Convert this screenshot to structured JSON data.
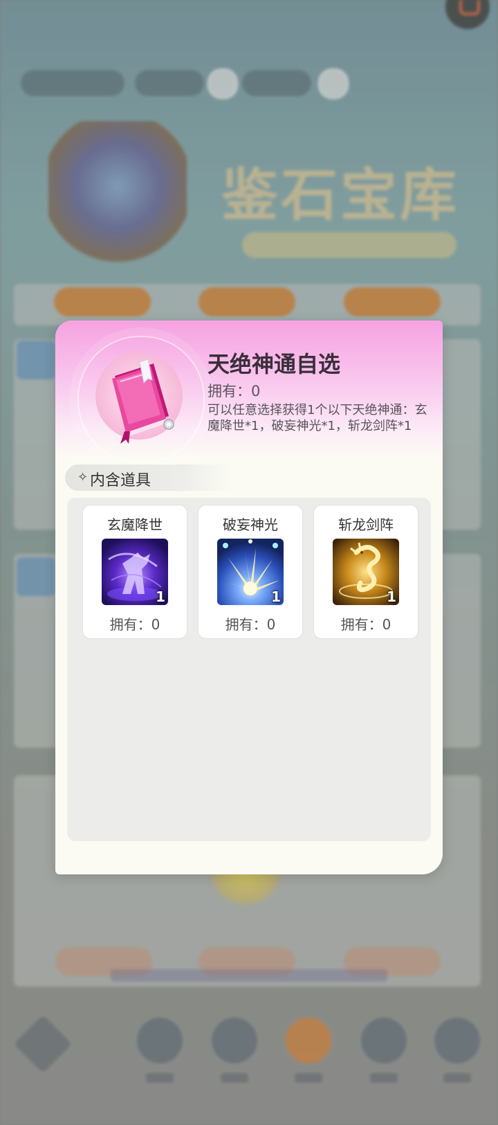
{
  "popup": {
    "title": "天绝神通自选",
    "owned": "拥有：0",
    "description": "可以任意选择获得1个以下天绝神通：玄魔降世*1，破妄神光*1，斩龙剑阵*1"
  },
  "contents": {
    "header": "内含道具",
    "header_icon": "✧",
    "items": [
      {
        "name": "玄魔降世",
        "quantity": "1",
        "owned": "拥有：0",
        "icon": "dark-demon-skill-icon"
      },
      {
        "name": "破妄神光",
        "quantity": "1",
        "owned": "拥有：0",
        "icon": "divine-light-burst-icon"
      },
      {
        "name": "斩龙剑阵",
        "quantity": "1",
        "owned": "拥有：0",
        "icon": "golden-dragon-sword-icon"
      }
    ]
  },
  "colors": {
    "header_pink": "#f6a2e0",
    "panel_bg": "#fbfbf4",
    "content_gray": "#ececea"
  }
}
